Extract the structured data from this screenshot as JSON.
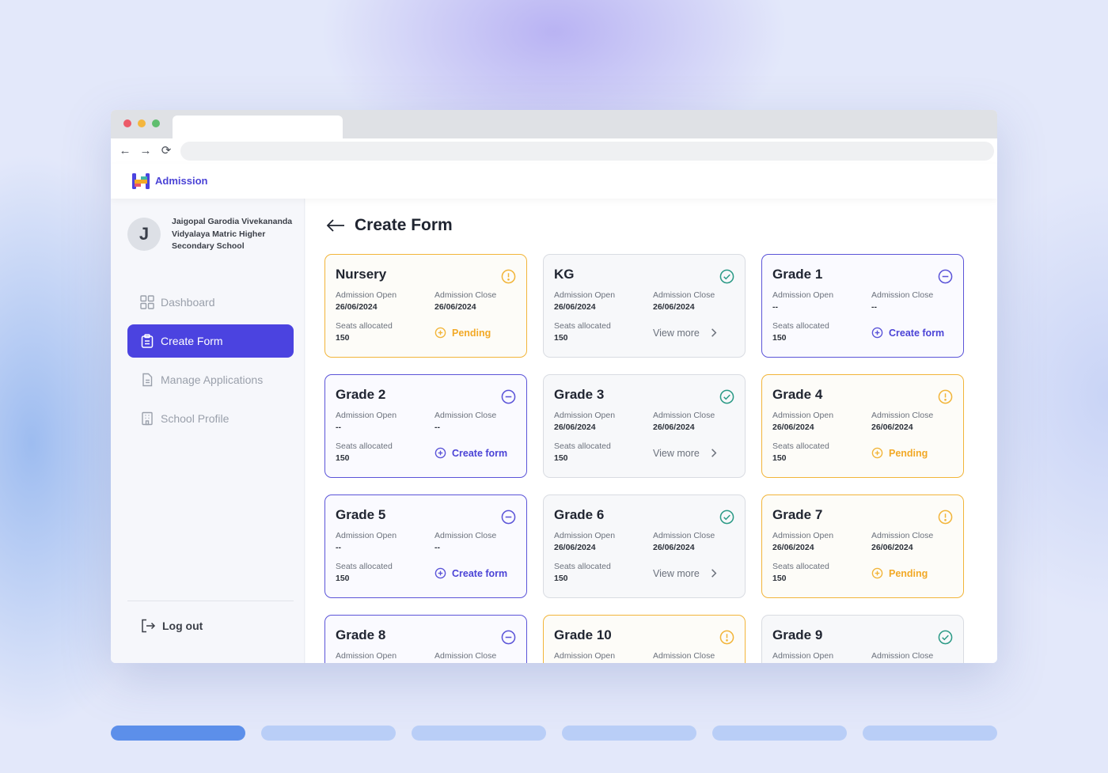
{
  "app": {
    "brand": "Admission",
    "title": "Create Form"
  },
  "sidebar": {
    "avatar_initial": "J",
    "school_name": "Jaigopal Garodia Vivekananda Vidyalaya Matric Higher Secondary School",
    "items": [
      {
        "label": "Dashboard",
        "icon": "grid-icon",
        "active": false
      },
      {
        "label": "Create Form",
        "icon": "clipboard-icon",
        "active": true
      },
      {
        "label": "Manage Applications",
        "icon": "document-icon",
        "active": false
      },
      {
        "label": "School Profile",
        "icon": "building-icon",
        "active": false
      }
    ],
    "logout_label": "Log out"
  },
  "labels": {
    "open": "Admission Open",
    "close": "Admission Close",
    "seats": "Seats allocated"
  },
  "cards": [
    {
      "grade": "Nursery",
      "status": "pending",
      "open": "26/06/2024",
      "close": "26/06/2024",
      "seats": "150",
      "action": "Pending"
    },
    {
      "grade": "KG",
      "status": "done",
      "open": "26/06/2024",
      "close": "26/06/2024",
      "seats": "150",
      "action": "View more"
    },
    {
      "grade": "Grade 1",
      "status": "draft",
      "open": "--",
      "close": "--",
      "seats": "150",
      "action": "Create form"
    },
    {
      "grade": "Grade 2",
      "status": "draft",
      "open": "--",
      "close": "--",
      "seats": "150",
      "action": "Create form"
    },
    {
      "grade": "Grade 3",
      "status": "done",
      "open": "26/06/2024",
      "close": "26/06/2024",
      "seats": "150",
      "action": "View more"
    },
    {
      "grade": "Grade 4",
      "status": "pending",
      "open": "26/06/2024",
      "close": "26/06/2024",
      "seats": "150",
      "action": "Pending"
    },
    {
      "grade": "Grade 5",
      "status": "draft",
      "open": "--",
      "close": "--",
      "seats": "150",
      "action": "Create form"
    },
    {
      "grade": "Grade 6",
      "status": "done",
      "open": "26/06/2024",
      "close": "26/06/2024",
      "seats": "150",
      "action": "View more"
    },
    {
      "grade": "Grade 7",
      "status": "pending",
      "open": "26/06/2024",
      "close": "26/06/2024",
      "seats": "150",
      "action": "Pending"
    },
    {
      "grade": "Grade 8",
      "status": "draft",
      "open": "",
      "close": "",
      "seats": "",
      "action": ""
    },
    {
      "grade": "Grade 10",
      "status": "pending",
      "open": "",
      "close": "",
      "seats": "",
      "action": ""
    },
    {
      "grade": "Grade 9",
      "status": "done",
      "open": "",
      "close": "",
      "seats": "",
      "action": ""
    }
  ],
  "colors": {
    "accent": "#4b43e0",
    "pending": "#f2b53a",
    "done": "#2b9a86",
    "draft": "#5b54d8"
  }
}
